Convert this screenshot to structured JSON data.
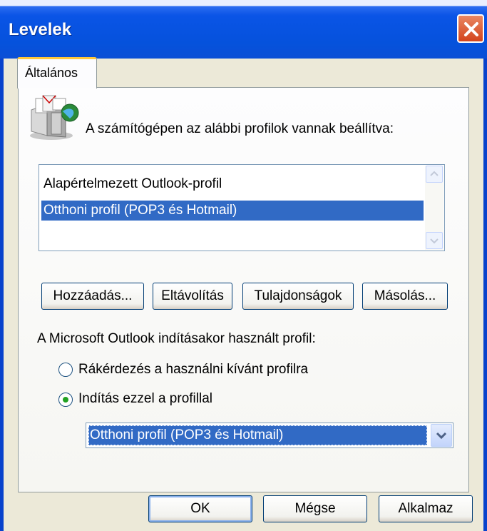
{
  "window": {
    "title": "Levelek"
  },
  "tabs": [
    {
      "label": "Általános"
    }
  ],
  "header_text": "A számítógépen az alábbi profilok vannak beállítva:",
  "profiles": [
    {
      "label": "Alapértelmezett Outlook-profil",
      "selected": false
    },
    {
      "label": "Otthoni profil (POP3 és Hotmail)",
      "selected": true
    }
  ],
  "profile_buttons": {
    "add": "Hozzáadás...",
    "remove": "Eltávolítás",
    "properties": "Tulajdonságok",
    "copy": "Másolás..."
  },
  "startup": {
    "label": "A Microsoft Outlook indításakor használt profil:",
    "option_prompt": "Rákérdezés a használni kívánt profilra",
    "option_always": "Indítás ezzel a profillal",
    "selected_option": "option_always",
    "profile_value": "Otthoni profil (POP3 és Hotmail)"
  },
  "dialog_buttons": {
    "ok": "OK",
    "cancel": "Mégse",
    "apply": "Alkalmaz"
  },
  "colors": {
    "title_bar": "#0a54e6",
    "selection": "#316ac5",
    "dialog_bg": "#ece9d8",
    "close_button": "#d3441c"
  }
}
